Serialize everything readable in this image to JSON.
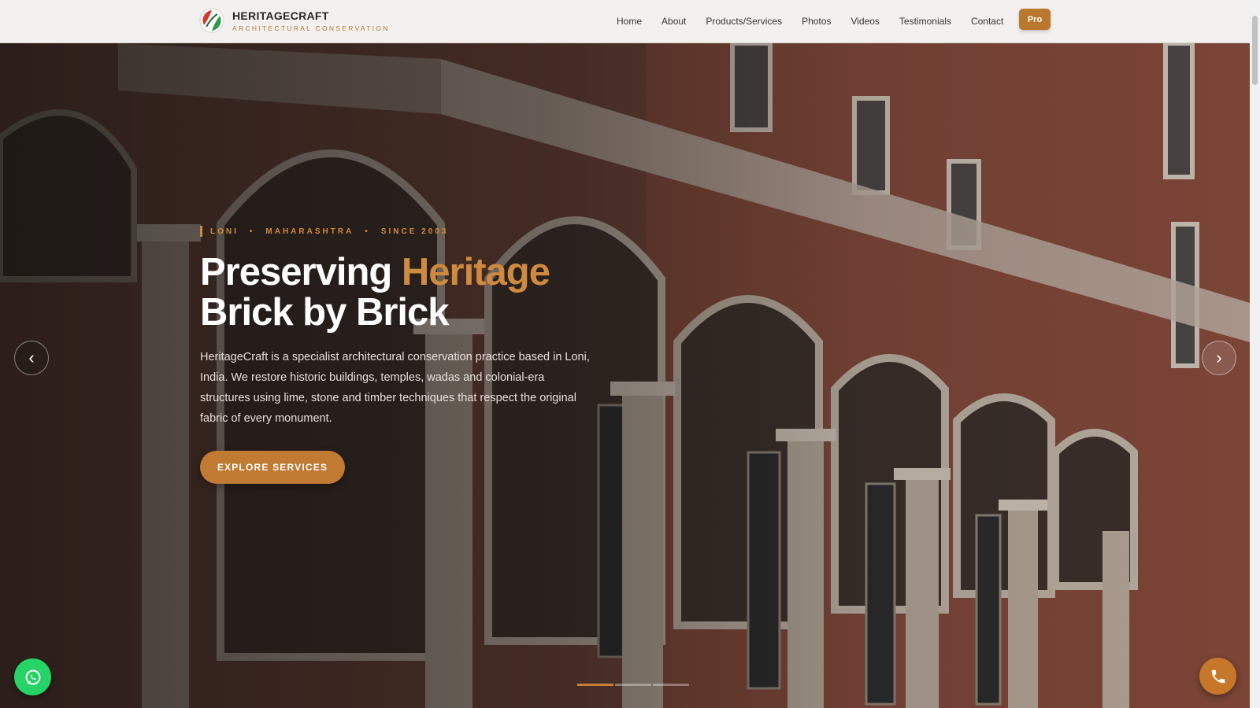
{
  "brand": {
    "name": "HERITAGECRAFT",
    "tagline": "ARCHITECTURAL CONSERVATION"
  },
  "nav": {
    "items": [
      {
        "label": "Home"
      },
      {
        "label": "About"
      },
      {
        "label": "Products/Services"
      },
      {
        "label": "Photos"
      },
      {
        "label": "Videos"
      },
      {
        "label": "Testimonials"
      },
      {
        "label": "Contact"
      }
    ],
    "pro_label": "Pro"
  },
  "hero": {
    "kicker": {
      "place": "LONI",
      "region": "MAHARASHTRA",
      "since": "SINCE 2003",
      "separator": "•"
    },
    "headline": {
      "part1": "Preserving ",
      "accent": "Heritage",
      "line2": "Brick by Brick"
    },
    "lead": "HeritageCraft is a specialist architectural conservation practice based in Loni, India. We restore historic buildings, temples, wadas and colonial-era structures using lime, stone and timber techniques that respect the original fabric of every monument.",
    "cta_label": "EXPLORE SERVICES",
    "prev_icon": "‹",
    "next_icon": "›",
    "slides": {
      "count": 3,
      "active_index": 0
    }
  },
  "colors": {
    "accent": "#c07a32",
    "whatsapp": "#25d366",
    "header_bg": "#f3f1ef"
  },
  "icons": {
    "logo": "heritagecraft-logo-icon",
    "whatsapp": "whatsapp-icon",
    "phone": "phone-icon",
    "prev": "chevron-left-icon",
    "next": "chevron-right-icon"
  }
}
